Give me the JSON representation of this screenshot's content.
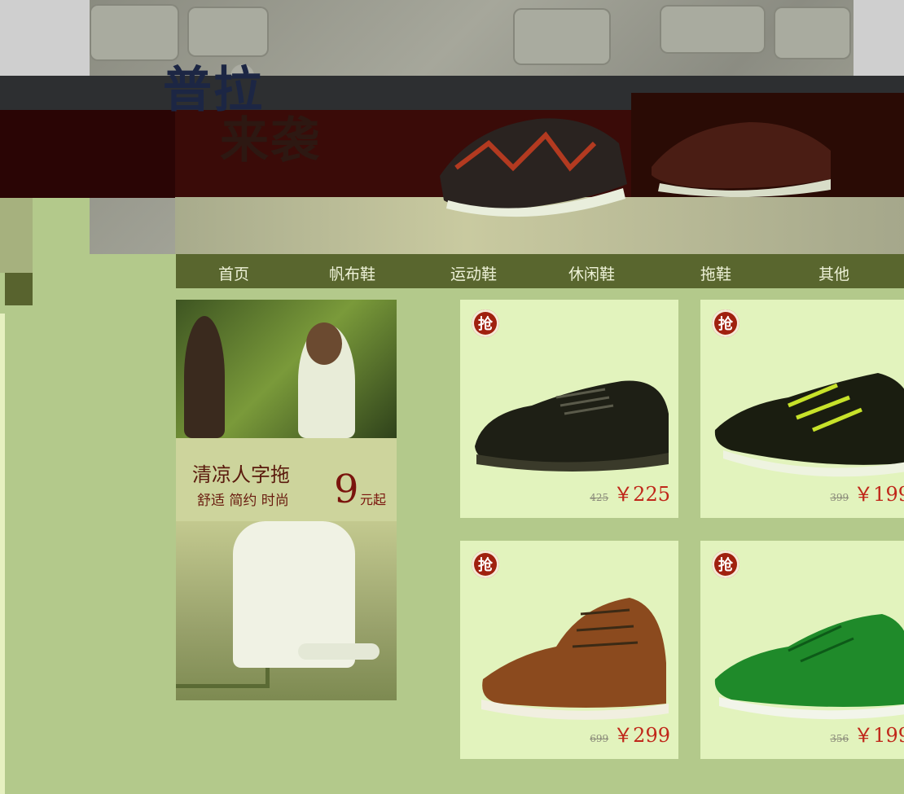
{
  "banner": {
    "title_line1": "普拉",
    "title_line2": "来袭"
  },
  "nav": {
    "items": [
      {
        "label": "首页"
      },
      {
        "label": "帆布鞋"
      },
      {
        "label": "运动鞋"
      },
      {
        "label": "休闲鞋"
      },
      {
        "label": "拖鞋"
      },
      {
        "label": "其他"
      }
    ]
  },
  "promo": {
    "title": "清凉人字拖",
    "subtitle": "舒适 简约 时尚",
    "price": "9",
    "price_suffix": "元起"
  },
  "products": [
    {
      "badge": "抢",
      "old_price": "425",
      "price": "￥225",
      "color": "#1e1f15"
    },
    {
      "badge": "抢",
      "old_price": "399",
      "price": "￥199",
      "color": "#1a1d10"
    },
    {
      "badge": "抢",
      "old_price": "699",
      "price": "￥299",
      "color": "#8b4a1e"
    },
    {
      "badge": "抢",
      "old_price": "356",
      "price": "￥199",
      "color": "#1f8a2a"
    }
  ],
  "colors": {
    "background": "#b3c98b",
    "nav": "#59662e",
    "card": "#e2f3bd",
    "price": "#c0271a"
  }
}
